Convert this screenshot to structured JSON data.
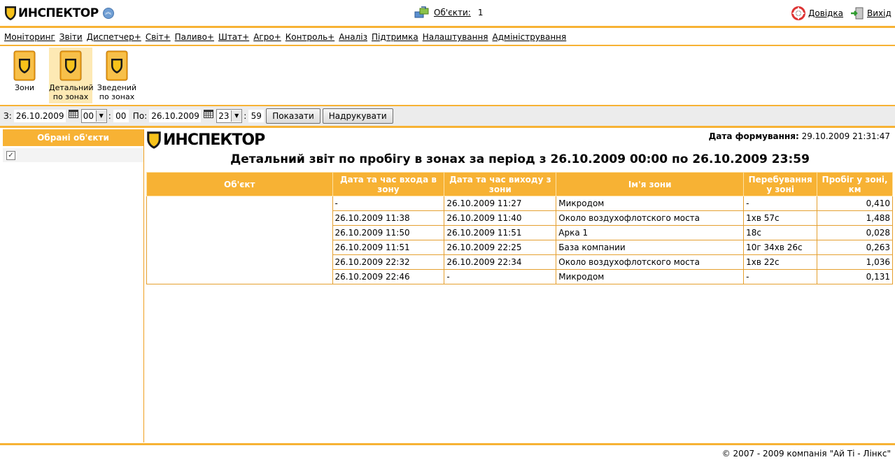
{
  "header": {
    "logo_text": "ИНСПЕКТОР",
    "objects_label": "Об'єкти:",
    "objects_count": "1",
    "help_label": "Довідка",
    "exit_label": "Вихід"
  },
  "menu": {
    "items": [
      "Моніторинг",
      "Звіти",
      "Диспетчер+",
      "Світ+",
      "Паливо+",
      "Штат+",
      "Агро+",
      "Контроль+",
      "Аналіз",
      "Підтримка",
      "Налаштування",
      "Адміністрування"
    ]
  },
  "reports": [
    {
      "line1": "Зони",
      "line2": "",
      "active": false
    },
    {
      "line1": "Детальний",
      "line2": "по зонах",
      "active": true
    },
    {
      "line1": "Зведений",
      "line2": "по зонах",
      "active": false
    }
  ],
  "filter": {
    "from_label": "З:",
    "from_date": "26.10.2009",
    "from_hour": "00",
    "from_min": "00",
    "to_label": "По:",
    "to_date": "26.10.2009",
    "to_hour": "23",
    "to_min": "59",
    "show_button": "Показати",
    "print_button": "Надрукувати"
  },
  "left_panel": {
    "title": "Обрані об'єкти",
    "checkbox_checked": true
  },
  "report": {
    "logo_text": "ИНСПЕКТОР",
    "generated_label": "Дата формування:",
    "generated_value": "29.10.2009 21:31:47",
    "title": "Детальний звіт по пробігу в зонах за період з 26.10.2009 00:00 по 26.10.2009 23:59",
    "columns": [
      "Об'єкт",
      "Дата та час входа в зону",
      "Дата та час виходу з зони",
      "Ім'я зони",
      "Перебування у зоні",
      "Пробіг у зоні, км"
    ],
    "object_name": "",
    "rows": [
      [
        "-",
        "26.10.2009 11:27",
        "Микродом",
        "-",
        "0,410"
      ],
      [
        "26.10.2009 11:38",
        "26.10.2009 11:40",
        "Около воздухофлотского моста",
        "1хв 57с",
        "1,488"
      ],
      [
        "26.10.2009 11:50",
        "26.10.2009 11:51",
        "Арка 1",
        "18с",
        "0,028"
      ],
      [
        "26.10.2009 11:51",
        "26.10.2009 22:25",
        "База компании",
        "10г 34хв 26с",
        "0,263"
      ],
      [
        "26.10.2009 22:32",
        "26.10.2009 22:34",
        "Около воздухофлотского моста",
        "1хв 22с",
        "1,036"
      ],
      [
        "26.10.2009 22:46",
        "-",
        "Микродом",
        "-",
        "0,131"
      ]
    ]
  },
  "footer": {
    "copyright": "© 2007 - 2009 компанія \"Ай Ті - Лінкс\""
  },
  "colors": {
    "accent": "#f7b234",
    "filter_bg": "#ececec",
    "active_tile": "#fde9b4"
  }
}
